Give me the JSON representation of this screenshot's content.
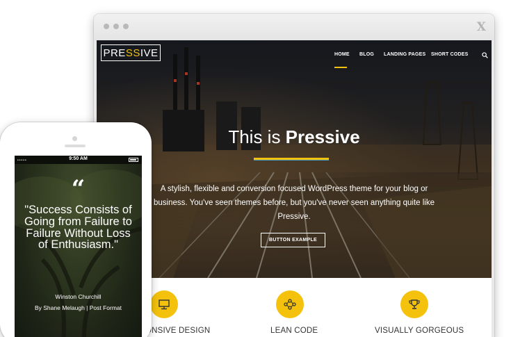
{
  "browser": {
    "close_glyph": "X"
  },
  "site": {
    "logo": {
      "part1": "PRE",
      "part2": "SS",
      "part3": "IVE"
    },
    "nav": {
      "home": "HOME",
      "blog": "BLOG",
      "landing_pages": "LANDING PAGES",
      "short_codes": "SHORT CODES",
      "search_icon": "search-icon"
    },
    "hero": {
      "title_prefix": "This is ",
      "title_bold": "Pressive",
      "description": "A stylish, flexible and conversion focused WordPress theme for your blog or business. You've seen themes before, but you've never seen anything quite like Pressive.",
      "button_label": "BUTTON EXAMPLE"
    },
    "features": [
      {
        "label": "ONSIVE DESIGN",
        "icon": "monitor-icon"
      },
      {
        "label": "LEAN CODE",
        "icon": "network-icon"
      },
      {
        "label": "VISUALLY GORGEOUS",
        "icon": "trophy-icon"
      }
    ]
  },
  "phone": {
    "time": "9:50 AM",
    "signal": "•••••",
    "quote_mark": "“",
    "quote": "\"Success Consists of Going from Failure to Failure Without Loss of Enthusiasm.\"",
    "author": "Winston Churchill",
    "meta": "By Shane Melaugh  |  Post Format"
  },
  "colors": {
    "accent": "#f4c20d",
    "dark_bg": "#2b2a2a"
  }
}
